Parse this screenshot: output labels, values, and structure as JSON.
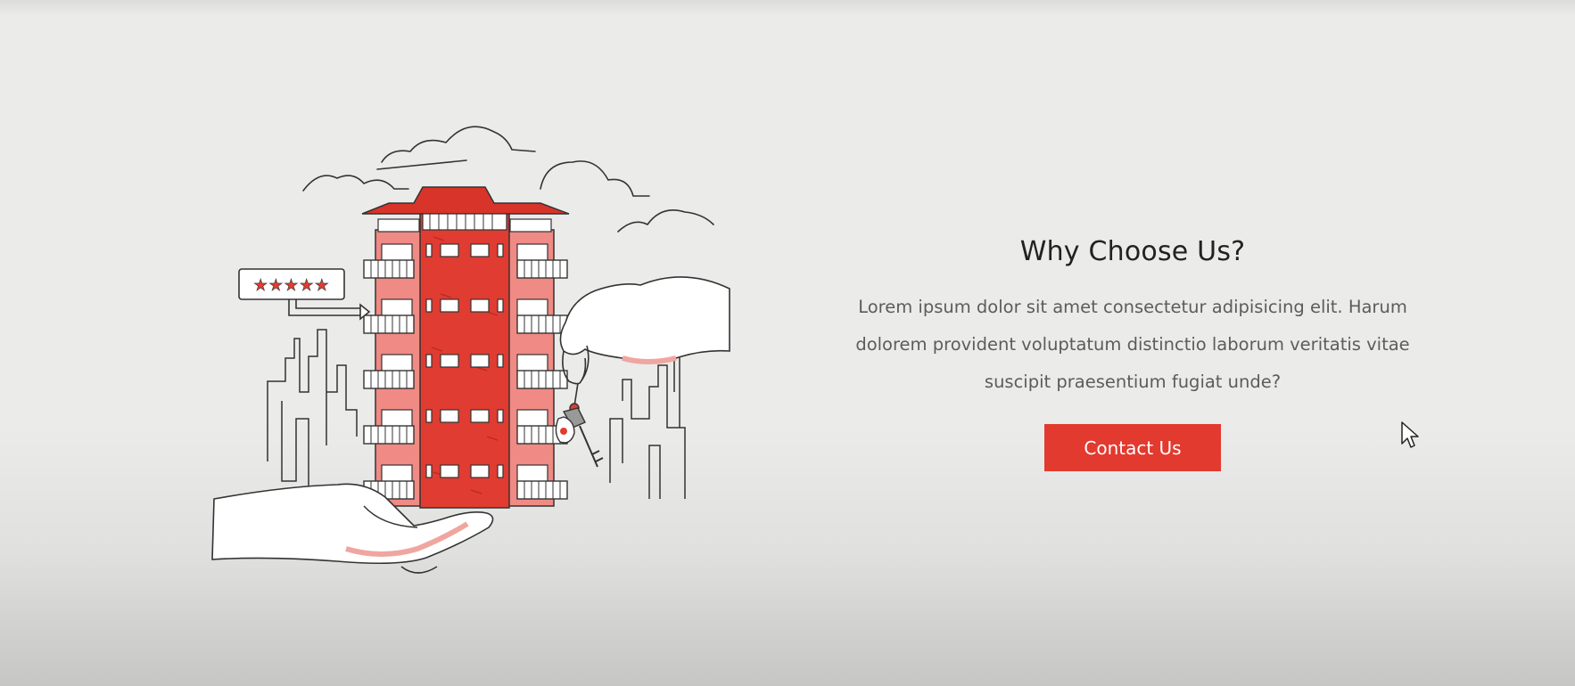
{
  "section": {
    "title": "Why Choose Us?",
    "body": "Lorem ipsum dolor sit amet consectetur adipisicing elit. Harum dolorem provident voluptatum distinctio laborum veritatis vitae suscipit praesentium fugiat unde?",
    "cta_label": "Contact Us"
  },
  "illustration": {
    "icon": "building-handover-illustration",
    "rating_stars": 5
  },
  "colors": {
    "accent": "#e23a2f",
    "building": "#e03c31",
    "building_light": "#f08a84",
    "title": "#222222",
    "body_text": "#5c5c5c",
    "background": "#ebebea"
  }
}
